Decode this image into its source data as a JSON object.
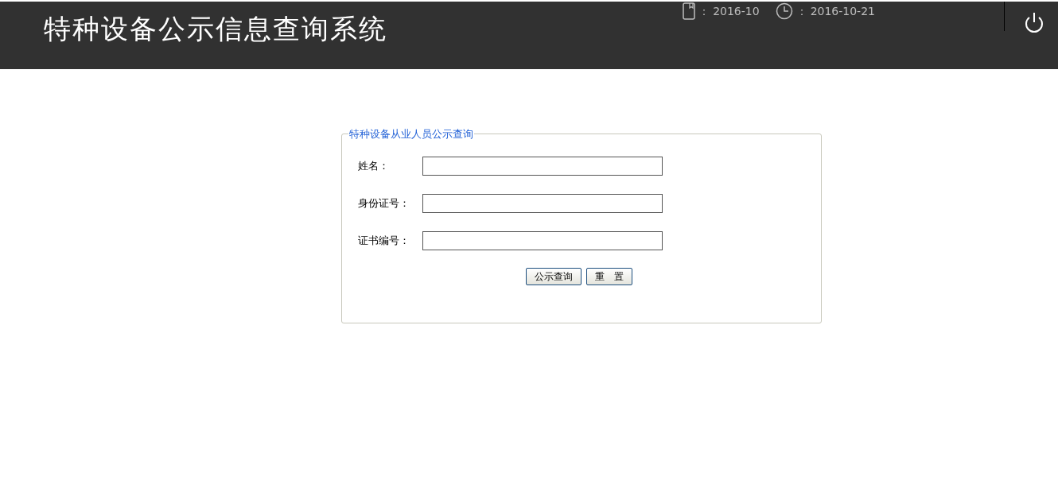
{
  "header": {
    "title": "特种设备公示信息查询系统",
    "month_label": "：",
    "month": "2016-10",
    "date_label": "：",
    "date": "2016-10-21"
  },
  "form": {
    "legend": "特种设备从业人员公示查询",
    "fields": [
      {
        "label": "姓名："
      },
      {
        "label": "身份证号："
      },
      {
        "label": "证书编号："
      }
    ],
    "buttons": [
      "公示查询",
      "重　置"
    ]
  }
}
